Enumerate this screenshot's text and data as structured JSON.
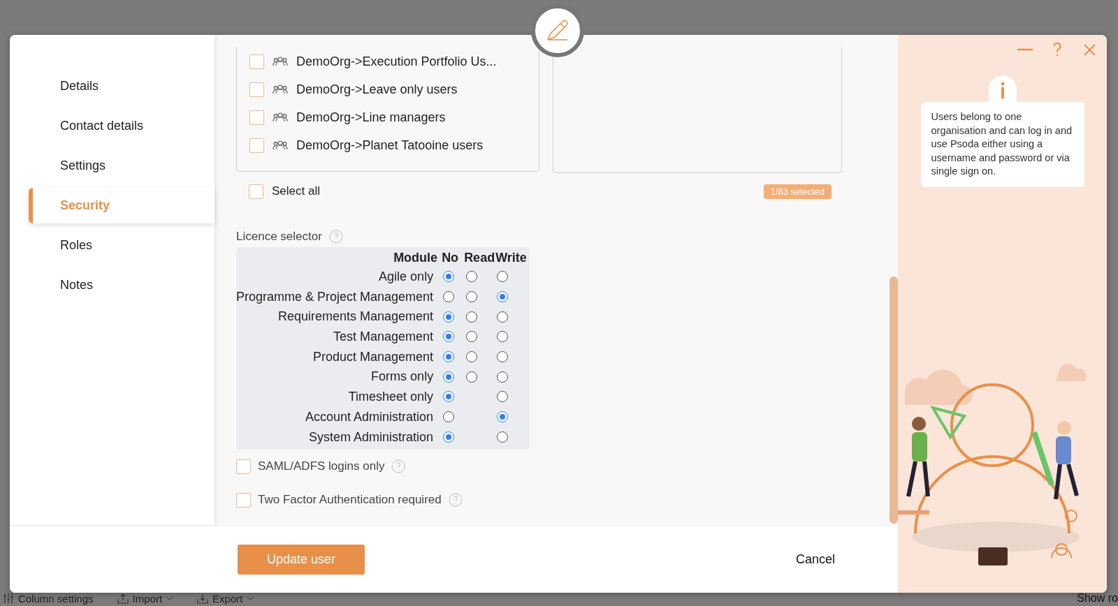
{
  "dialog": {
    "nav": [
      {
        "label": "Details",
        "selected": false
      },
      {
        "label": "Contact details",
        "selected": false
      },
      {
        "label": "Settings",
        "selected": false
      },
      {
        "label": "Security",
        "selected": true
      },
      {
        "label": "Roles",
        "selected": false
      },
      {
        "label": "Notes",
        "selected": false
      }
    ],
    "groups": {
      "items": [
        {
          "label": "DemoOrg->Execution Portfolio Us...",
          "checked": false
        },
        {
          "label": "DemoOrg->Leave only users",
          "checked": false
        },
        {
          "label": "DemoOrg->Line managers",
          "checked": false
        },
        {
          "label": "DemoOrg->Planet Tatooine users",
          "checked": false
        }
      ],
      "select_all": {
        "label": "Select all",
        "checked": false
      },
      "selected_count": "1/83 selected"
    },
    "licence": {
      "label": "Licence selector",
      "columns": [
        "Module",
        "No",
        "Read",
        "Write"
      ],
      "rows": [
        {
          "module": "Agile only",
          "options": [
            {
              "kind": "no",
              "selected": true
            },
            {
              "kind": "read",
              "selected": false
            },
            {
              "kind": "write",
              "selected": false
            }
          ]
        },
        {
          "module": "Programme & Project Management",
          "options": [
            {
              "kind": "no",
              "selected": false
            },
            {
              "kind": "read",
              "selected": false
            },
            {
              "kind": "write",
              "selected": true
            }
          ]
        },
        {
          "module": "Requirements Management",
          "options": [
            {
              "kind": "no",
              "selected": true
            },
            {
              "kind": "read",
              "selected": false
            },
            {
              "kind": "write",
              "selected": false
            }
          ]
        },
        {
          "module": "Test Management",
          "options": [
            {
              "kind": "no",
              "selected": true
            },
            {
              "kind": "read",
              "selected": false
            },
            {
              "kind": "write",
              "selected": false
            }
          ]
        },
        {
          "module": "Product Management",
          "options": [
            {
              "kind": "no",
              "selected": true
            },
            {
              "kind": "read",
              "selected": false
            },
            {
              "kind": "write",
              "selected": false
            }
          ]
        },
        {
          "module": "Forms only",
          "options": [
            {
              "kind": "no",
              "selected": true
            },
            {
              "kind": "read",
              "selected": false
            },
            {
              "kind": "write",
              "selected": false
            }
          ]
        },
        {
          "module": "Timesheet only",
          "options": [
            {
              "kind": "no",
              "selected": true
            },
            {
              "kind": "write",
              "selected": false
            }
          ]
        },
        {
          "module": "Account Administration",
          "options": [
            {
              "kind": "no",
              "selected": false
            },
            {
              "kind": "write",
              "selected": true
            }
          ]
        },
        {
          "module": "System Administration",
          "options": [
            {
              "kind": "no",
              "selected": true
            },
            {
              "kind": "write",
              "selected": false
            }
          ]
        }
      ]
    },
    "options": [
      {
        "label": "SAML/ADFS logins only",
        "checked": false
      },
      {
        "label": "Two Factor Authentication required",
        "checked": false
      }
    ],
    "footer": {
      "primary": "Update user",
      "cancel": "Cancel"
    },
    "help_panel": {
      "info": "Users belong to one organisation and can log in and use Psoda either using a username and password or via single sign on."
    }
  },
  "background_toolbar": {
    "items": [
      "Column settings",
      "Import",
      "Export"
    ],
    "right": "Show ro"
  }
}
